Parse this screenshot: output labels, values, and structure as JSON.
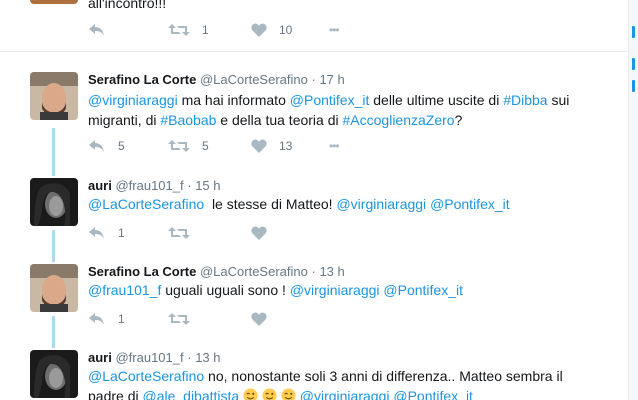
{
  "top_tweet": {
    "text_tail": "all'incontro!!!",
    "retweets": "1",
    "likes": "10"
  },
  "tweets": [
    {
      "name": "Serafino La Corte",
      "handle": "@LaCorteSerafino",
      "time": "17 h",
      "line1": [
        {
          "t": "@virginiaraggi",
          "link": true
        },
        {
          "t": " ma hai informato ",
          "link": false
        },
        {
          "t": "@Pontifex_it",
          "link": true
        },
        {
          "t": " delle ultime uscite di ",
          "link": false
        },
        {
          "t": "#Dibba",
          "link": true
        },
        {
          "t": " sui",
          "link": false
        }
      ],
      "line2": [
        {
          "t": "migranti, di ",
          "link": false
        },
        {
          "t": "#Baobab",
          "link": true
        },
        {
          "t": " e della tua teoria di ",
          "link": false
        },
        {
          "t": "#AccoglienzaZero",
          "link": true
        },
        {
          "t": "?",
          "link": false
        }
      ],
      "replies": "5",
      "retweets": "5",
      "likes": "13"
    },
    {
      "name": "auri",
      "handle": "@frau101_f",
      "time": "15 h",
      "line1": [
        {
          "t": "@LaCorteSerafino",
          "link": true
        },
        {
          "t": "  le stesse di Matteo! ",
          "link": false
        },
        {
          "t": "@virginiaraggi",
          "link": true
        },
        {
          "t": " ",
          "link": false
        },
        {
          "t": "@Pontifex_it",
          "link": true
        }
      ],
      "replies": "1",
      "retweets": "",
      "likes": ""
    },
    {
      "name": "Serafino La Corte",
      "handle": "@LaCorteSerafino",
      "time": "13 h",
      "line1": [
        {
          "t": "@frau101_f",
          "link": true
        },
        {
          "t": " uguali uguali sono ! ",
          "link": false
        },
        {
          "t": "@virginiaraggi",
          "link": true
        },
        {
          "t": " ",
          "link": false
        },
        {
          "t": "@Pontifex_it",
          "link": true
        }
      ],
      "replies": "1",
      "retweets": "",
      "likes": ""
    },
    {
      "name": "auri",
      "handle": "@frau101_f",
      "time": "13 h",
      "line1": [
        {
          "t": "@LaCorteSerafino",
          "link": true
        },
        {
          "t": " no, nonostante soli 3 anni di differenza.. Matteo sembra il",
          "link": false
        }
      ],
      "line2": [
        {
          "t": "padre di ",
          "link": false
        },
        {
          "t": "@ale_dibattista",
          "link": true
        },
        {
          "t": " ",
          "link": false
        },
        {
          "t": "@virginiaraggi",
          "link": true
        },
        {
          "t": " ",
          "link": false
        },
        {
          "t": "@Pontifex_it",
          "link": true
        }
      ],
      "emoji_count": 3
    }
  ],
  "dot": "·",
  "more": "•••",
  "colors": {
    "link": "#1b95e0",
    "muted": "#657786",
    "icon": "#aab8c2",
    "thread_line": "#a9dbf2"
  }
}
